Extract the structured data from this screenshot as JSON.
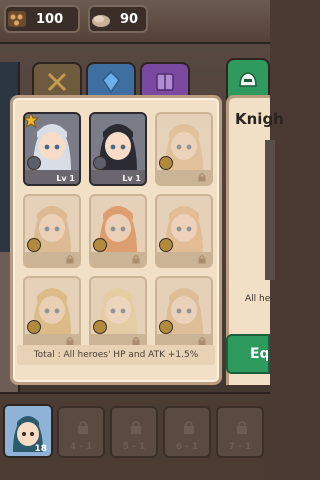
{
  "resources": {
    "wood": {
      "icon": "wood-log-icon",
      "value": "100"
    },
    "stone": {
      "icon": "stone-ore-icon",
      "value": "90"
    }
  },
  "tabs": [
    {
      "icon": "crossed-swords-icon",
      "color": "#6e5a3c"
    },
    {
      "icon": "blue-crystal-icon",
      "color": "#3f6ea0"
    },
    {
      "icon": "spell-book-icon",
      "color": "#7a4aa0"
    },
    {
      "icon": "knight-helmet-icon",
      "color": "#2f9a5e"
    }
  ],
  "heroes": [
    {
      "state": "owned",
      "star": true,
      "level": "Lv 1"
    },
    {
      "state": "owned",
      "star": false,
      "level": "Lv 1"
    },
    {
      "state": "locked"
    },
    {
      "state": "locked"
    },
    {
      "state": "locked"
    },
    {
      "state": "locked"
    },
    {
      "state": "locked"
    },
    {
      "state": "locked"
    },
    {
      "state": "locked"
    }
  ],
  "bonus_text": "Total : All heroes' HP and ATK +1.5%",
  "detail": {
    "title": "Knigh",
    "desc": "All he",
    "equip_label": "Eq"
  },
  "bottom": {
    "hero_count": "18",
    "locked_slots": [
      "4 - 1",
      "5 - 1",
      "6 - 1",
      "7 - 1"
    ]
  },
  "colors": {
    "panel": "#f1e0c6",
    "accent_green": "#2f9a5e"
  }
}
